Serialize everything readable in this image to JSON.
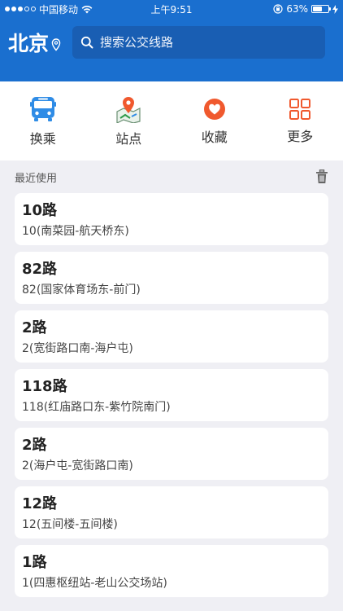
{
  "status_bar": {
    "carrier": "中国移动",
    "time": "上午9:51",
    "battery": "63%",
    "battery_level": 0.63
  },
  "header": {
    "city": "北京",
    "search_placeholder": "搜索公交线路"
  },
  "quick_actions": [
    {
      "label": "换乘",
      "icon": "bus-icon"
    },
    {
      "label": "站点",
      "icon": "map-pin-icon"
    },
    {
      "label": "收藏",
      "icon": "heart-icon"
    },
    {
      "label": "更多",
      "icon": "grid-icon"
    }
  ],
  "recent": {
    "title": "最近使用",
    "items": [
      {
        "route": "10路",
        "desc": "10(南菜园-航天桥东)"
      },
      {
        "route": "82路",
        "desc": "82(国家体育场东-前门)"
      },
      {
        "route": "2路",
        "desc": "2(宽街路口南-海户屯)"
      },
      {
        "route": "118路",
        "desc": "118(红庙路口东-紫竹院南门)"
      },
      {
        "route": "2路",
        "desc": "2(海户屯-宽街路口南)"
      },
      {
        "route": "12路",
        "desc": "12(五间楼-五间楼)"
      },
      {
        "route": "1路",
        "desc": "1(四惠枢纽站-老山公交场站)"
      }
    ]
  },
  "colors": {
    "primary": "#1a6fcf",
    "search_bg": "#195eb3",
    "accent": "#f0592e",
    "page_bg": "#efeff4"
  }
}
